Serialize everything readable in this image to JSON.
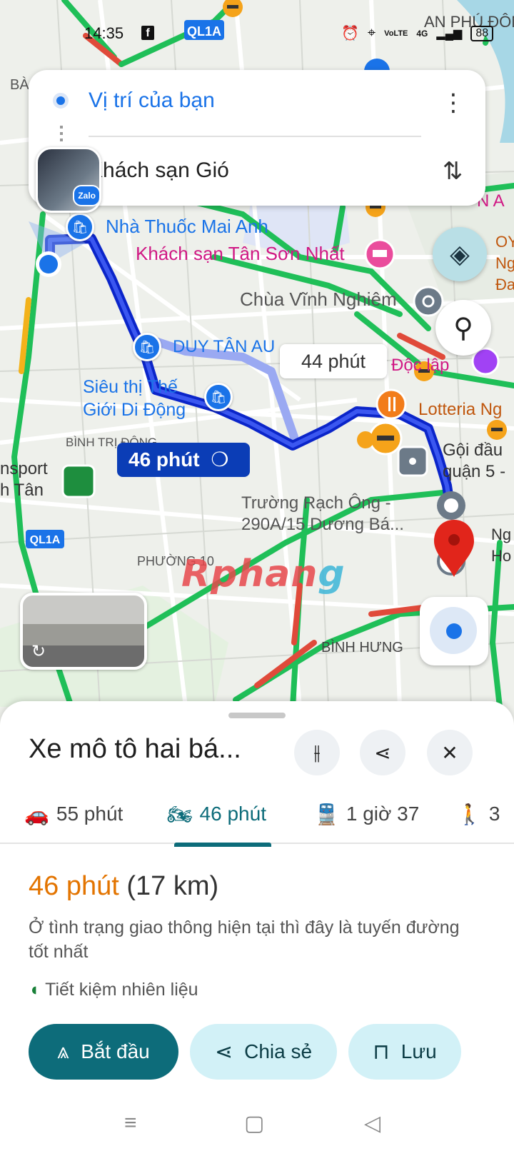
{
  "status_bar": {
    "time": "14:35",
    "fb_label": "f",
    "road_badge": "QL1A",
    "battery": "88",
    "indicators": [
      "⏰",
      "⌖",
      "VoLTE",
      "4G",
      "▂▄▆"
    ]
  },
  "map": {
    "labels": {
      "pharmacy": "Nhà Thuốc Mai Anh",
      "hotel": "Khách sạn Tân Sơn Nhất",
      "hotel_top": "Tân Sơn Nhất",
      "pagoda": "Chùa Vĩnh Nghiêm",
      "duy_tan": "DUY TÂN AU",
      "sieu_thi": "Siêu thị Thế\nGiới Di Động",
      "binh_tri_dong": "BÌNH TRỊ ĐÔNG",
      "transport": "nsport\nh Tân",
      "doc_lap": "Độc lập",
      "lotteria": "Lotteria Ng",
      "goi_dau": "Gội đầu\nquận 5 -",
      "truong_rach_ong": "Trường Rạch Ông -\n290A/15 Dương Bá...",
      "phuong10": "PHƯỜNG 10",
      "binh_hung": "BÌNH HƯNG",
      "an_phu_dong": "AN PHÚ ĐÔN",
      "ba": "BÀ",
      "ql1a": "QL1A",
      "right_edge_1": "N A",
      "right_edge_2": "OY\nNg\nĐa",
      "right_edge_3": "Ng\nHo"
    },
    "route_label": "46 phút",
    "alt_route_label": "44 phút",
    "watermark_a": "Rphan",
    "watermark_b": "g"
  },
  "search": {
    "origin": "Vị trí của bạn",
    "destination": "Khách sạn Gió",
    "zalo_badge": "Zalo"
  },
  "sheet": {
    "title": "Xe mô tô hai bá...",
    "tabs": [
      {
        "icon": "car-icon",
        "label": "55 phút"
      },
      {
        "icon": "motorbike-icon",
        "label": "46 phút"
      },
      {
        "icon": "transit-icon",
        "label": "1 giờ 37"
      },
      {
        "icon": "walk-icon",
        "label": "3"
      }
    ],
    "duration": "46 phút",
    "distance": "(17 km)",
    "description": "Ở tình trạng giao thông hiện tại thì đây là tuyến đường tốt nhất",
    "eco": "Tiết kiệm nhiên liệu",
    "buttons": {
      "start": "Bắt đầu",
      "share": "Chia sẻ",
      "save": "Lưu"
    }
  },
  "colors": {
    "route": "#1a2fd6",
    "alt_route": "#9aa9f2",
    "traffic_green": "#1fbf58",
    "traffic_red": "#e04a3a",
    "traffic_yellow": "#f3b21a",
    "accent": "#0d6c7a",
    "orange": "#e37400"
  }
}
